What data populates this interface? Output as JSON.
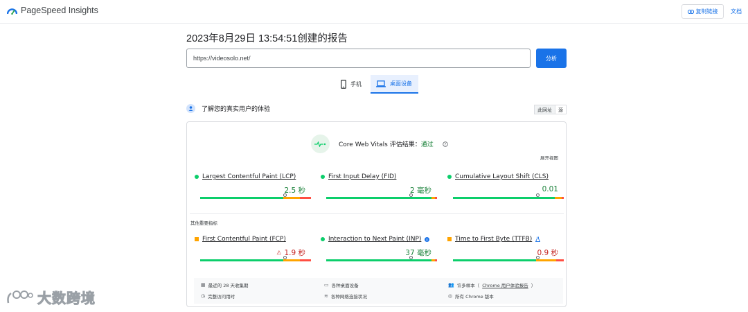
{
  "app": {
    "name": "PageSpeed Insights"
  },
  "header": {
    "copy_link": "复制链接",
    "docs": "文档"
  },
  "report": {
    "title": "2023年8月29日 13:54:51创建的报告"
  },
  "search": {
    "url": "https://videosolo.net/",
    "analyze": "分析"
  },
  "tabs": [
    {
      "label": "手机",
      "active": false
    },
    {
      "label": "桌面设备",
      "active": true
    }
  ],
  "section": {
    "title": "了解您的真实用户的体验",
    "toggle_url": "此网址",
    "toggle_origin": "源"
  },
  "cwv": {
    "label": "Core Web Vitals 评估结果：",
    "result": "通过",
    "expand": "展开视图"
  },
  "core_metrics": [
    {
      "name": "Largest Contentful Paint (LCP)",
      "value": "2.5 秒",
      "status": "good",
      "marker_fraction": 0.75
    },
    {
      "name": "First Input Delay (FID)",
      "value": "2 毫秒",
      "status": "good",
      "marker_fraction": 0.75
    },
    {
      "name": "Cumulative Layout Shift (CLS)",
      "value": "0.01",
      "status": "good",
      "marker_fraction": 0.75
    }
  ],
  "other_label": "其他重要指标",
  "other_metrics": [
    {
      "name": "First Contentful Paint (FCP)",
      "value": "1.9 秒",
      "status": "needs-improvement",
      "marker_fraction": 0.75
    },
    {
      "name": "Interaction to Next Paint (INP)",
      "value": "37 毫秒",
      "status": "good",
      "marker_fraction": 0.75
    },
    {
      "name": "Time to First Byte (TTFB)",
      "value": "0.9 秒",
      "status": "needs-improvement",
      "marker_fraction": 0.75
    }
  ],
  "footer": {
    "period": "最近的 28 天收集期",
    "devices": "各种桌面设备",
    "samples_prefix": "许多样本（",
    "samples_link": "Chrome 用户体验报告",
    "samples_suffix": "）",
    "visit": "完整访问用时",
    "network": "各种网络连接状况",
    "chrome": "所有 Chrome 版本"
  },
  "watermark": {
    "text": "大数跨境"
  },
  "colors": {
    "accent": "#1a73e8",
    "good": "#0cce6b",
    "average": "#ffa400",
    "poor": "#ff4e42",
    "good_text": "#188038",
    "poor_text": "#c5221f"
  }
}
